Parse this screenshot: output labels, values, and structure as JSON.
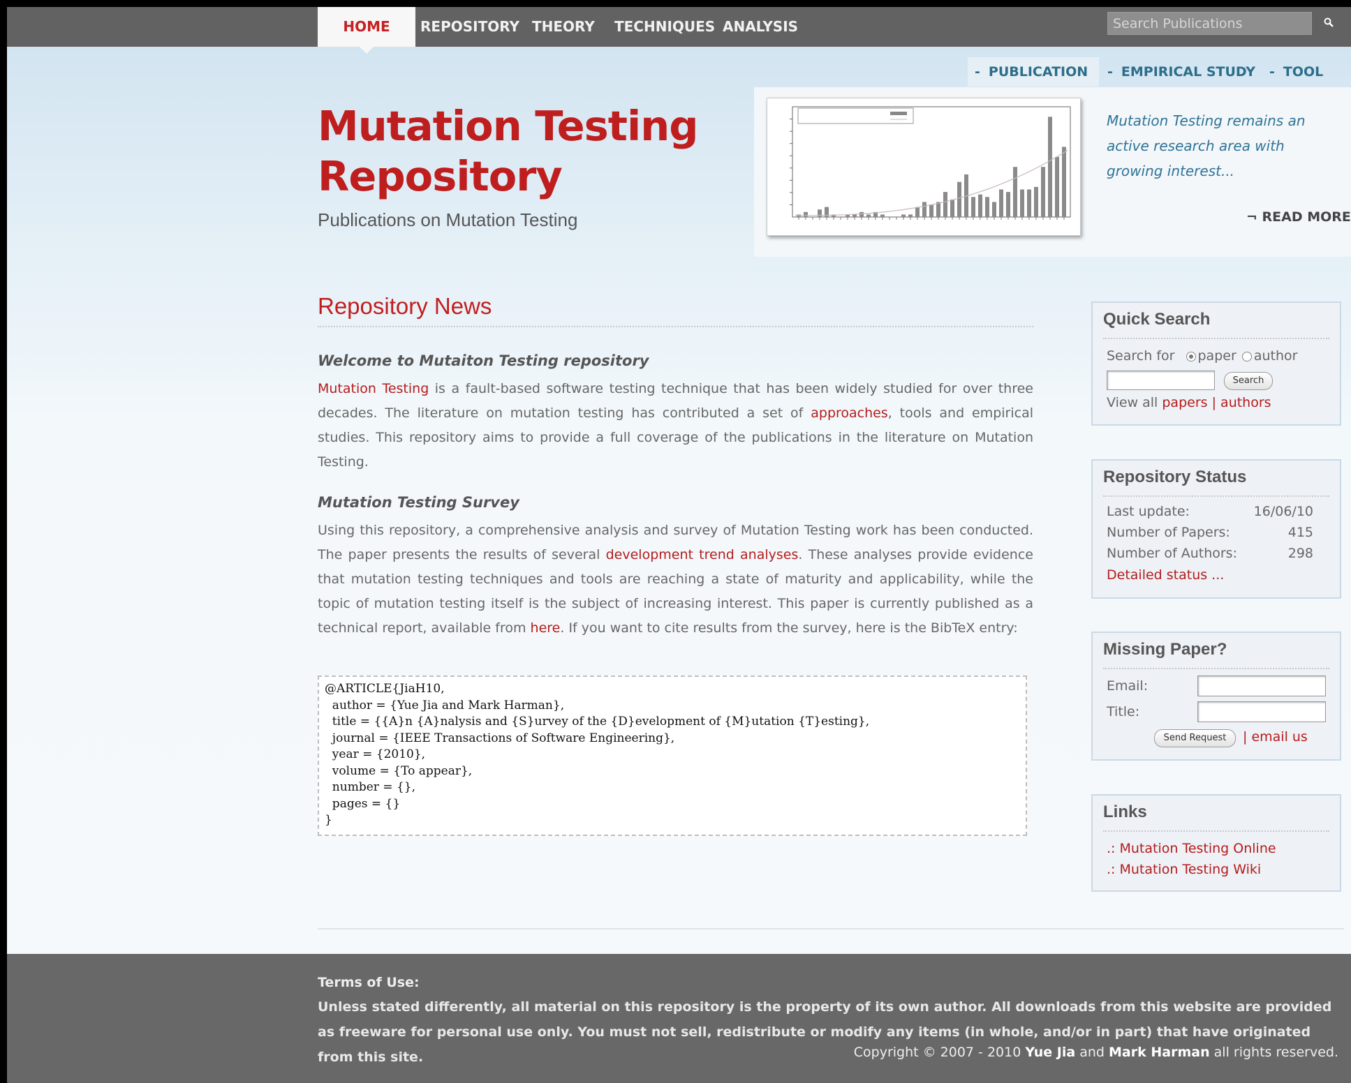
{
  "nav": {
    "tabs": [
      {
        "label": "HOME",
        "active": true
      },
      {
        "label": "REPOSITORY"
      },
      {
        "label": "THEORY"
      },
      {
        "label": "TECHNIQUES"
      },
      {
        "label": "ANALYSIS"
      }
    ],
    "search_placeholder": "Search Publications",
    "search_icon": "magnifier"
  },
  "subnav": {
    "items": [
      {
        "label": "PUBLICATION",
        "active": true
      },
      {
        "label": "EMPIRICAL STUDY"
      },
      {
        "label": "TOOL"
      }
    ],
    "bullet": "-"
  },
  "header": {
    "title_line1": "Mutation Testing",
    "title_line2": "Repository",
    "subtitle": "Publications on Mutation Testing"
  },
  "feature": {
    "chart_kind": "bar",
    "text": "Mutation Testing remains an active research area with growing interest...",
    "read_more": "READ MORE",
    "read_more_arrow": "¬"
  },
  "chart_data": {
    "type": "bar",
    "values": [
      1,
      2,
      0,
      3,
      4,
      1,
      0,
      1,
      1,
      2,
      1,
      2,
      1,
      0,
      0,
      1,
      1,
      4,
      6,
      5,
      6,
      10,
      7,
      14,
      17,
      8,
      9,
      8,
      6,
      11,
      10,
      20,
      11,
      11,
      12,
      20,
      40,
      24,
      28
    ],
    "trend_line": true,
    "bar_color": "#8a8a8a"
  },
  "news": {
    "title": "Repository News",
    "sections": [
      {
        "heading": "Welcome to Mutaiton Testing repository",
        "parts": [
          {
            "link": "Mutation Testing"
          },
          {
            "text": " is a fault-based software testing technique that has been widely studied for over three decades. The literature on mutation testing has contributed a set of "
          },
          {
            "link": "approaches"
          },
          {
            "text": ", tools and empirical studies. This repository aims to provide a full coverage of the publications in the literature on Mutation Testing."
          }
        ]
      },
      {
        "heading": "Mutation Testing Survey",
        "parts": [
          {
            "text": "Using this repository, a comprehensive analysis and survey of Mutation Testing work has been conducted. The paper presents the results of several "
          },
          {
            "link": "development trend analyses"
          },
          {
            "text": ". These analyses provide evidence that mutation testing techniques and tools are reaching a state of maturity and applicability, while the topic of mutation testing itself is the subject of increasing interest. This paper is currently published as a technical report, available from "
          },
          {
            "link": "here"
          },
          {
            "text": ". If you want to cite results from the survey, here is the BibTeX entry:"
          }
        ]
      }
    ],
    "bibtex": "@ARTICLE{JiaH10,\n  author = {Yue Jia and Mark Harman},\n  title = {{A}n {A}nalysis and {S}urvey of the {D}evelopment of {M}utation {T}esting},\n  journal = {IEEE Transactions of Software Engineering},\n  year = {2010},\n  volume = {To appear},\n  number = {},\n  pages = {}\n}"
  },
  "quick_search": {
    "title": "Quick Search",
    "search_for": "Search for",
    "option_paper": "paper",
    "option_author": "author",
    "selected": "paper",
    "button": "Search",
    "view_all": "View all",
    "papers_link": "papers",
    "separator": "|",
    "authors_link": "authors"
  },
  "status": {
    "title": "Repository Status",
    "rows": [
      {
        "label": "Last update:",
        "value": "16/06/10"
      },
      {
        "label": "Number of Papers:",
        "value": "415"
      },
      {
        "label": "Number of Authors:",
        "value": "298"
      }
    ],
    "detail_link": "Detailed status ..."
  },
  "missing": {
    "title": "Missing Paper?",
    "email_label": "Email:",
    "title_label": "Title:",
    "button": "Send Request",
    "separator": "|",
    "email_link": "email us"
  },
  "links": {
    "title": "Links",
    "items": [
      ".: Mutation Testing Online",
      ".: Mutation Testing Wiki"
    ]
  },
  "footer": {
    "terms_label": "Terms of Use:",
    "terms_text": "Unless stated differently, all material on this repository is the property of its own author. All downloads from this website are provided as freeware for personal use only. You must not sell, redistribute or modify any items (in whole, and/or in part) that have originated from this site.",
    "copyright_prefix": "Copyright © 2007 - 2010",
    "author1": "Yue Jia",
    "and": "and",
    "author2": "Mark Harman",
    "copyright_suffix": "all rights reserved."
  },
  "colors": {
    "accent_red": "#bf1e1e",
    "nav_bg": "#626262",
    "sub_blue": "#2c6d8a"
  }
}
